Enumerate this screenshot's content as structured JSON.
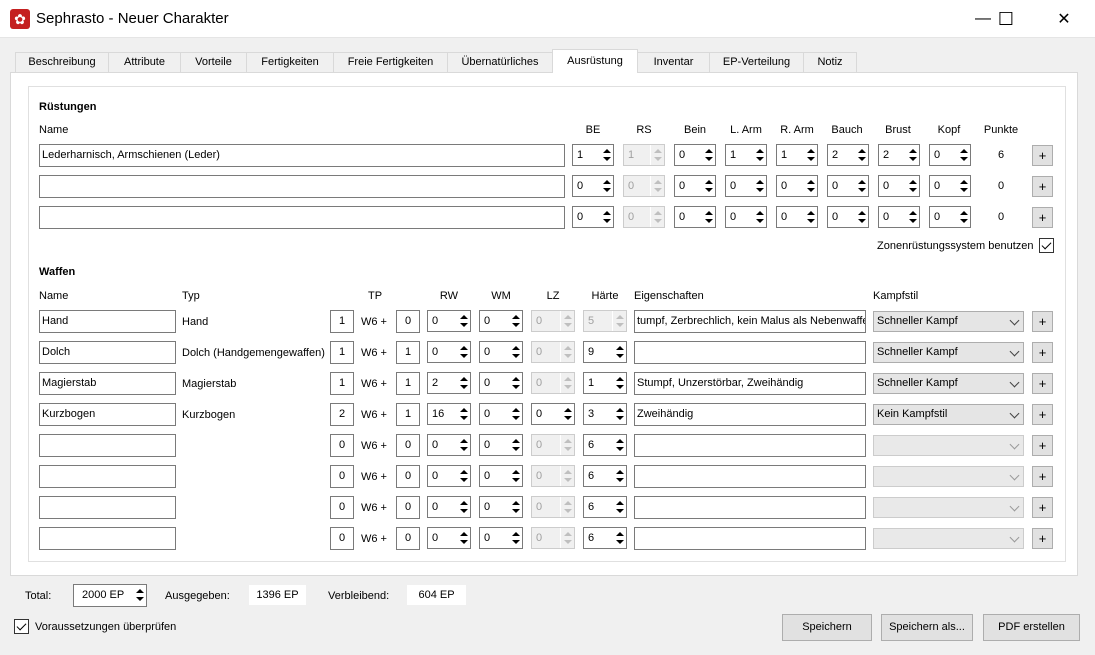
{
  "window": {
    "title": "Sephrasto - Neuer Charakter",
    "minimize": "—",
    "maximize": "☐",
    "close": "✕"
  },
  "tabs": [
    "Beschreibung",
    "Attribute",
    "Vorteile",
    "Fertigkeiten",
    "Freie Fertigkeiten",
    "Übernatürliches",
    "Ausrüstung",
    "Inventar",
    "EP-Verteilung",
    "Notiz"
  ],
  "active_tab": "Ausrüstung",
  "armor": {
    "section_title": "Rüstungen",
    "headers": {
      "name": "Name",
      "be": "BE",
      "rs": "RS",
      "bein": "Bein",
      "larm": "L. Arm",
      "rarm": "R. Arm",
      "bauch": "Bauch",
      "brust": "Brust",
      "kopf": "Kopf",
      "punkte": "Punkte"
    },
    "rows": [
      {
        "name": "Lederharnisch, Armschienen (Leder)",
        "be": "1",
        "rs": "1",
        "bein": "0",
        "larm": "1",
        "rarm": "1",
        "bauch": "2",
        "brust": "2",
        "kopf": "0",
        "punkte": "6",
        "add": "+"
      },
      {
        "name": "",
        "be": "0",
        "rs": "0",
        "bein": "0",
        "larm": "0",
        "rarm": "0",
        "bauch": "0",
        "brust": "0",
        "kopf": "0",
        "punkte": "0",
        "add": "+"
      },
      {
        "name": "",
        "be": "0",
        "rs": "0",
        "bein": "0",
        "larm": "0",
        "rarm": "0",
        "bauch": "0",
        "brust": "0",
        "kopf": "0",
        "punkte": "0",
        "add": "+"
      }
    ],
    "zone_label": "Zonenrüstungssystem benutzen",
    "zone_checked": true
  },
  "weapons": {
    "section_title": "Waffen",
    "headers": {
      "name": "Name",
      "typ": "Typ",
      "tp": "TP",
      "rw": "RW",
      "wm": "WM",
      "lz": "LZ",
      "haerte": "Härte",
      "eig": "Eigenschaften",
      "kampfstil": "Kampfstil"
    },
    "w6": "W6 +",
    "rows": [
      {
        "name": "Hand",
        "typ": "Hand",
        "dice": "1",
        "plus": "0",
        "rw": "0",
        "wm": "0",
        "lz": "0",
        "lz_enabled": false,
        "haerte": "5",
        "haerte_enabled": false,
        "eig": "tumpf, Zerbrechlich, kein Malus als Nebenwaffe",
        "stil": "Schneller Kampf",
        "stil_enabled": true,
        "add": "+"
      },
      {
        "name": "Dolch",
        "typ": "Dolch (Handgemengewaffen)",
        "dice": "1",
        "plus": "1",
        "rw": "0",
        "wm": "0",
        "lz": "0",
        "lz_enabled": false,
        "haerte": "9",
        "haerte_enabled": true,
        "eig": "",
        "stil": "Schneller Kampf",
        "stil_enabled": true,
        "add": "+"
      },
      {
        "name": "Magierstab",
        "typ": "Magierstab",
        "dice": "1",
        "plus": "1",
        "rw": "2",
        "wm": "0",
        "lz": "0",
        "lz_enabled": false,
        "haerte": "1",
        "haerte_enabled": true,
        "eig": "Stumpf, Unzerstörbar, Zweihändig",
        "stil": "Schneller Kampf",
        "stil_enabled": true,
        "add": "+"
      },
      {
        "name": "Kurzbogen",
        "typ": "Kurzbogen",
        "dice": "2",
        "plus": "1",
        "rw": "16",
        "wm": "0",
        "lz": "0",
        "lz_enabled": true,
        "haerte": "3",
        "haerte_enabled": true,
        "eig": "Zweihändig",
        "stil": "Kein Kampfstil",
        "stil_enabled": true,
        "add": "+"
      },
      {
        "name": "",
        "typ": "",
        "dice": "0",
        "plus": "0",
        "rw": "0",
        "wm": "0",
        "lz": "0",
        "lz_enabled": false,
        "haerte": "6",
        "haerte_enabled": true,
        "eig": "",
        "stil": "",
        "stil_enabled": false,
        "add": "+"
      },
      {
        "name": "",
        "typ": "",
        "dice": "0",
        "plus": "0",
        "rw": "0",
        "wm": "0",
        "lz": "0",
        "lz_enabled": false,
        "haerte": "6",
        "haerte_enabled": true,
        "eig": "",
        "stil": "",
        "stil_enabled": false,
        "add": "+"
      },
      {
        "name": "",
        "typ": "",
        "dice": "0",
        "plus": "0",
        "rw": "0",
        "wm": "0",
        "lz": "0",
        "lz_enabled": false,
        "haerte": "6",
        "haerte_enabled": true,
        "eig": "",
        "stil": "",
        "stil_enabled": false,
        "add": "+"
      },
      {
        "name": "",
        "typ": "",
        "dice": "0",
        "plus": "0",
        "rw": "0",
        "wm": "0",
        "lz": "0",
        "lz_enabled": false,
        "haerte": "6",
        "haerte_enabled": true,
        "eig": "",
        "stil": "",
        "stil_enabled": false,
        "add": "+"
      }
    ]
  },
  "footer": {
    "total_label": "Total:",
    "total_value": "2000 EP",
    "spent_label": "Ausgegeben:",
    "spent_value": "1396 EP",
    "remaining_label": "Verbleibend:",
    "remaining_value": "604 EP",
    "check_label": "Voraussetzungen überprüfen",
    "check_checked": true,
    "save": "Speichern",
    "save_as": "Speichern als...",
    "pdf": "PDF erstellen"
  }
}
